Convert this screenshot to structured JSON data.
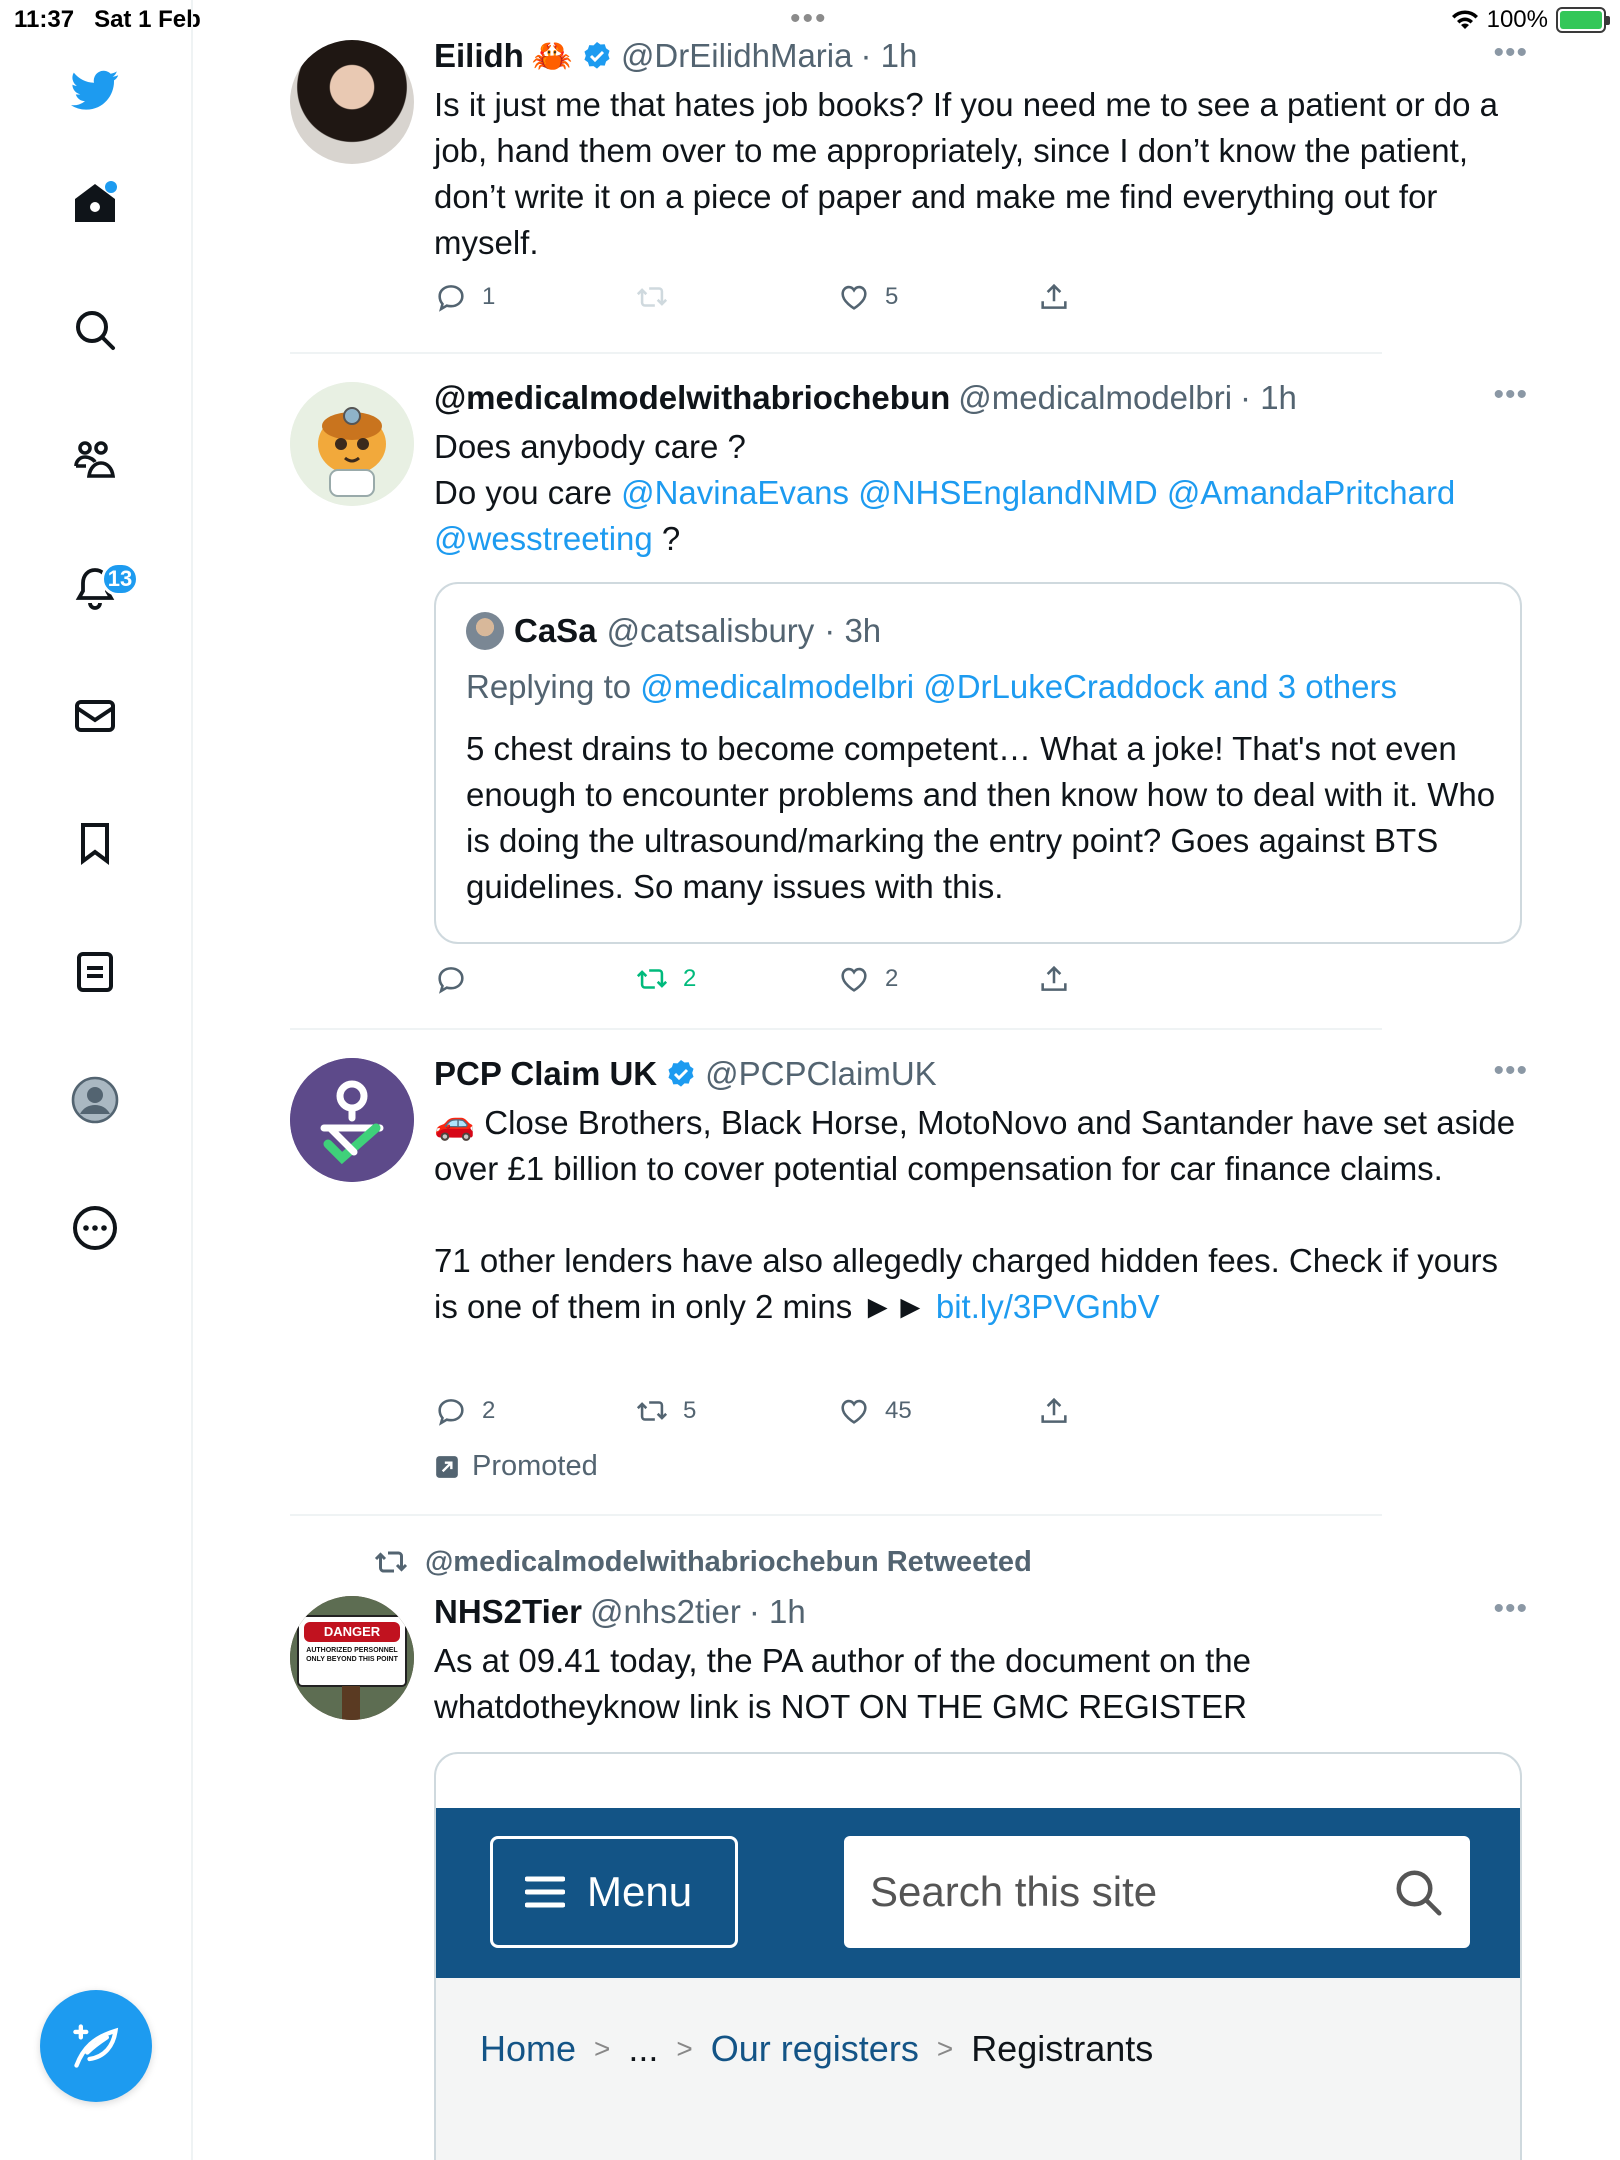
{
  "status_bar": {
    "time": "11:37",
    "date": "Sat 1 Feb",
    "battery": "100%"
  },
  "sidebar": {
    "notifications_count": "13"
  },
  "tweets": [
    {
      "name": "Eilidh",
      "name_emoji": "🦀",
      "handle": "@DrEilidhMaria",
      "time": "· 1h",
      "text": "Is it just me that hates job books? If you need me to see a patient or do a job, hand them over to me appropriately, since I don’t know the patient, don’t write it on a piece of paper and make me find everything out for myself.",
      "replies": "1",
      "retweets": "",
      "likes": "5"
    },
    {
      "name": "@medicalmodelwithabriochebun",
      "handle": "@medicalmodelbri",
      "time": "· 1h",
      "text_line1": "Does anybody care ?",
      "text_line2_prefix": "Do you care ",
      "mentions": [
        "@NavinaEvans",
        "@NHSEnglandNMD",
        "@AmandaPritchard",
        "@wesstreeting"
      ],
      "text_suffix": " ?",
      "quote": {
        "name": "CaSa",
        "handle": "@catsalisbury",
        "time": "· 3h",
        "replying_prefix": "Replying to ",
        "replying_to": "@medicalmodelbri @DrLukeCraddock and 3 others",
        "text": "5 chest drains to become competent… What a joke! That's not even enough to encounter problems and then know how to deal with it. Who is doing the ultrasound/marking the entry point? Goes against BTS guidelines. So many issues with this."
      },
      "replies": "",
      "retweets": "2",
      "likes": "2"
    },
    {
      "name": "PCP Claim UK",
      "handle": "@PCPClaimUK",
      "text_emoji": "🚗",
      "text_p1": " Close Brothers, Black Horse, MotoNovo and Santander have set aside over £1 billion to cover potential compensation for car finance claims.",
      "text_p2": "71 other lenders have also allegedly charged hidden fees. Check if yours is one of them in only 2 mins ►► ",
      "link": "bit.ly/3PVGnbV",
      "replies": "2",
      "retweets": "5",
      "likes": "45",
      "promoted": "Promoted"
    },
    {
      "retweeted_by": "@medicalmodelwithabriochebun Retweeted",
      "name": "NHS2Tier",
      "handle": "@nhs2tier",
      "time": "· 1h",
      "text": "As at 09.41 today, the PA author of the document on the whatdotheyknow link is NOT ON THE GMC REGISTER",
      "avatar_sign": {
        "top": "DANGER",
        "body": "AUTHORIZED PERSONNEL ONLY BEYOND THIS POINT"
      },
      "card": {
        "menu_label": "Menu",
        "search_placeholder": "Search this site",
        "breadcrumbs": [
          "Home",
          "...",
          "Our registers",
          "Registrants"
        ]
      }
    }
  ],
  "colors": {
    "accent": "#1d9bf0",
    "retweet_green": "#00ba7c",
    "secondary_text": "#536471",
    "gmc_blue": "#135486"
  }
}
